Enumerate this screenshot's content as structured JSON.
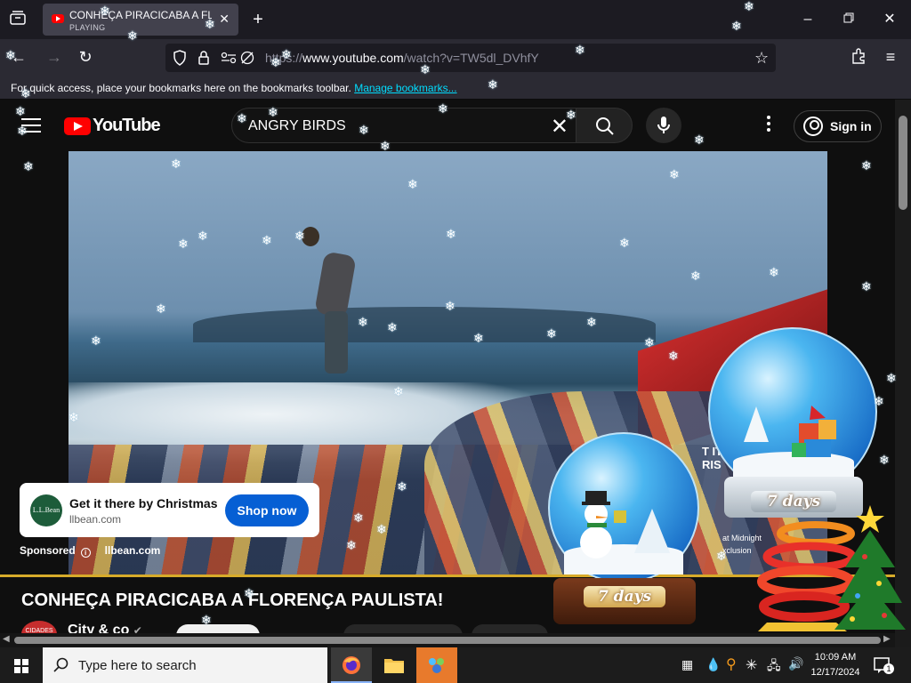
{
  "browser": {
    "tab": {
      "title": "CONHEÇA PIRACICABA A FLOR",
      "status": "PLAYING"
    },
    "url_prefix": "https://",
    "url_domain": "www.youtube.com",
    "url_path": "/watch?v=TW5dl_DVhfY",
    "bookmarks_message": "For quick access, place your bookmarks here on the bookmarks toolbar.",
    "bookmarks_link": "Manage bookmarks..."
  },
  "youtube": {
    "logo_text": "YouTube",
    "search_value": "ANGRY BIRDS",
    "sign_in": "Sign in"
  },
  "video": {
    "overlay_line1": "T IT",
    "overlay_line1b": "RIS",
    "overlay_line2": "at Midnight",
    "overlay_line3": "xclusion"
  },
  "ad": {
    "logo_text": "L.L.Bean",
    "headline": "Get it there by Christmas",
    "domain": "llbean.com",
    "cta": "Shop now",
    "sponsored": "Sponsored",
    "sponsored_domain": "llbean.com"
  },
  "watch": {
    "title": "CONHEÇA PIRACICABA A FLORENÇA PAULISTA!",
    "channel": "City & co",
    "channel_avatar_text": "CIDADES"
  },
  "countdown": {
    "globe1_label": "7 days",
    "globe2_label": "7 days"
  },
  "taskbar": {
    "search_placeholder": "Type here to search",
    "time": "10:09 AM",
    "date": "12/17/2024",
    "notification_count": "1"
  },
  "colors": {
    "youtube_red": "#ff0000",
    "cta_blue": "#065fd4",
    "link_cyan": "#00ddff",
    "progress_gold": "#d7ab2a"
  }
}
